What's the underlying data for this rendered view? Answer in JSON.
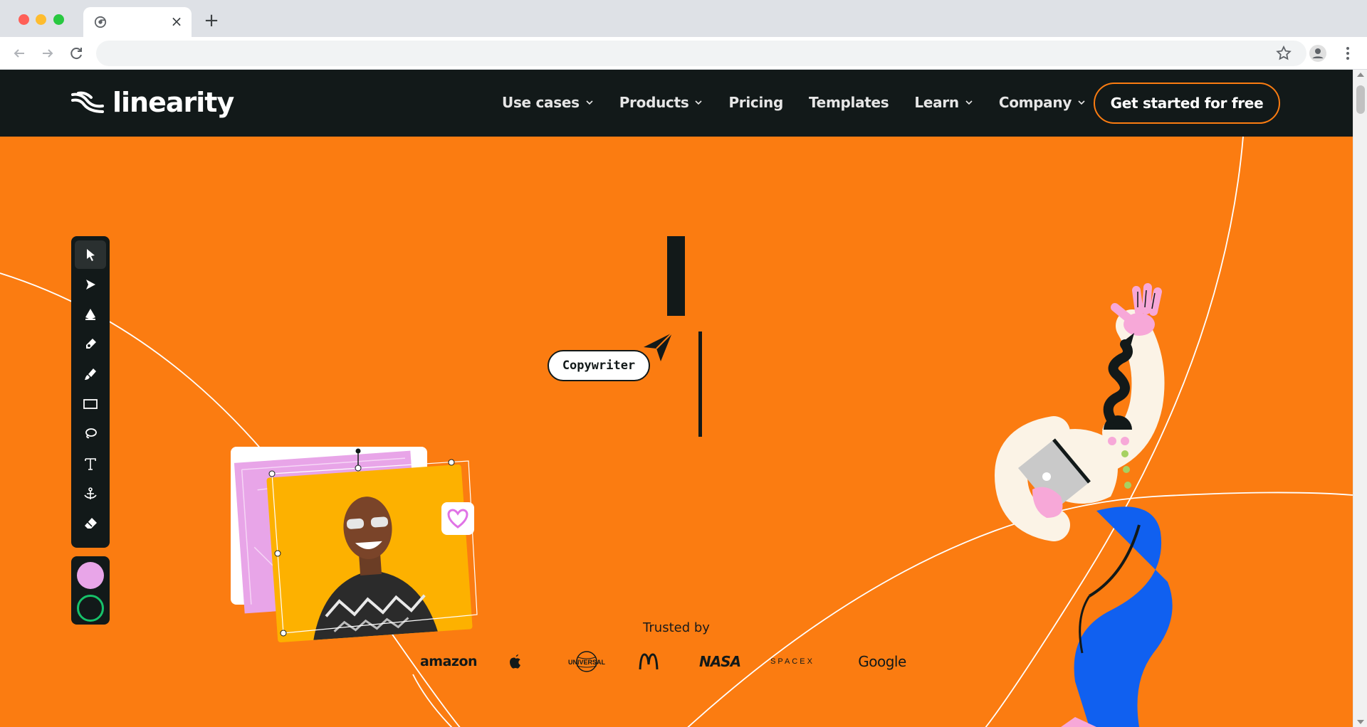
{
  "browser": {
    "tab_title": "",
    "new_tab_label": "+",
    "tab_close_label": "×",
    "address": ""
  },
  "site": {
    "brand_name": "linearity",
    "colors": {
      "header_bg": "#121919",
      "hero_bg": "#fb7c11",
      "cta_border": "#fb7c11"
    },
    "nav": [
      {
        "label": "Use cases",
        "has_dropdown": true
      },
      {
        "label": "Products",
        "has_dropdown": true
      },
      {
        "label": "Pricing",
        "has_dropdown": false
      },
      {
        "label": "Templates",
        "has_dropdown": false
      },
      {
        "label": "Learn",
        "has_dropdown": true
      },
      {
        "label": "Company",
        "has_dropdown": true
      }
    ],
    "cta_label": "Get started for free"
  },
  "hero": {
    "cursor_tag_label": "Copywriter",
    "tools": [
      {
        "name": "selection-tool-icon"
      },
      {
        "name": "node-tool-icon"
      },
      {
        "name": "pen-tool-icon"
      },
      {
        "name": "pencil-tool-icon"
      },
      {
        "name": "brush-tool-icon"
      },
      {
        "name": "rectangle-tool-icon"
      },
      {
        "name": "lasso-tool-icon"
      },
      {
        "name": "text-tool-icon"
      },
      {
        "name": "anchor-tool-icon"
      },
      {
        "name": "eraser-tool-icon"
      }
    ],
    "fill_color": "#e8a5e8",
    "stroke_color": "#17c26a"
  },
  "trusted": {
    "label": "Trusted by",
    "logos": [
      "amazon",
      "apple",
      "UNIVERSAL",
      "M",
      "NASA",
      "SPACEX",
      "Google"
    ]
  }
}
